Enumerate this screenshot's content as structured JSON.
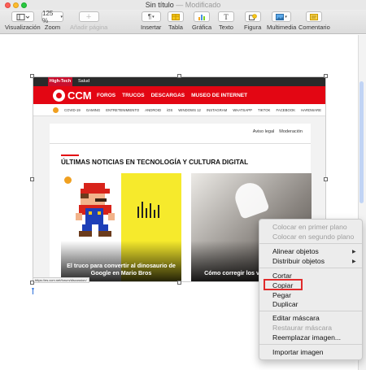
{
  "window": {
    "title": "Sin título",
    "dash": "—",
    "subtitle": "Modificado"
  },
  "toolbar": {
    "left": [
      {
        "id": "view",
        "label": "Visualización",
        "icon": "sidebar-icon"
      },
      {
        "id": "zoom",
        "label": "Zoom",
        "value": "125 %"
      },
      {
        "id": "addpage",
        "label": "Añadir página",
        "icon": "plus-icon",
        "disabled": true
      }
    ],
    "right": [
      {
        "id": "insert",
        "label": "Insertar",
        "icon": "paragraph-icon"
      },
      {
        "id": "table",
        "label": "Tabla",
        "icon": "table-icon"
      },
      {
        "id": "chart",
        "label": "Gráfica",
        "icon": "chart-icon"
      },
      {
        "id": "text",
        "label": "Texto",
        "icon": "text-icon"
      },
      {
        "id": "shape",
        "label": "Figura",
        "icon": "shape-icon"
      },
      {
        "id": "media",
        "label": "Multimedia",
        "icon": "media-icon"
      },
      {
        "id": "comment",
        "label": "Comentario",
        "icon": "comment-icon"
      }
    ]
  },
  "image": {
    "topnav": [
      "High-Tech",
      "Salud"
    ],
    "logo": "CCM",
    "mainnav": [
      "FOROS",
      "TRUCOS",
      "DESCARGAS",
      "MUSEO DE INTERNET"
    ],
    "subnav": [
      "COVID-19",
      "GAMING",
      "ENTRETENIMIENTO",
      "ANDROID",
      "iOS",
      "WINDOWS 12",
      "INSTAGRAM",
      "WHATSAPP",
      "TIKTOK",
      "FACEBOOK",
      "HARDWARE"
    ],
    "legal": [
      "Aviso legal",
      "Moderación"
    ],
    "heading": "ÚLTIMAS NOTICIAS EN TECNOLOGÍA Y CULTURA DIGITAL",
    "cards": [
      {
        "title": "El truco para convertir al dinosaurio de Google en Mario Bros"
      },
      {
        "title": "Cómo corregir los vi... de Snapc..."
      }
    ],
    "url": "https://es.ccm.net/forum/discussion/"
  },
  "context_menu": {
    "items": [
      {
        "label": "Colocar en primer plano",
        "disabled": true
      },
      {
        "label": "Colocar en segundo plano",
        "disabled": true
      },
      {
        "label": "Alinear objetos",
        "submenu": true
      },
      {
        "label": "Distribuir objetos",
        "submenu": true
      },
      {
        "label": "Cortar"
      },
      {
        "label": "Copiar",
        "highlighted": true
      },
      {
        "label": "Pegar"
      },
      {
        "label": "Duplicar"
      },
      {
        "label": "Editar máscara"
      },
      {
        "label": "Restaurar máscara",
        "disabled": true
      },
      {
        "label": "Reemplazar imagen..."
      },
      {
        "label": "Importar imagen"
      }
    ]
  },
  "colors": {
    "brand_red": "#e30613",
    "highlight_box": "#e02b2b"
  }
}
